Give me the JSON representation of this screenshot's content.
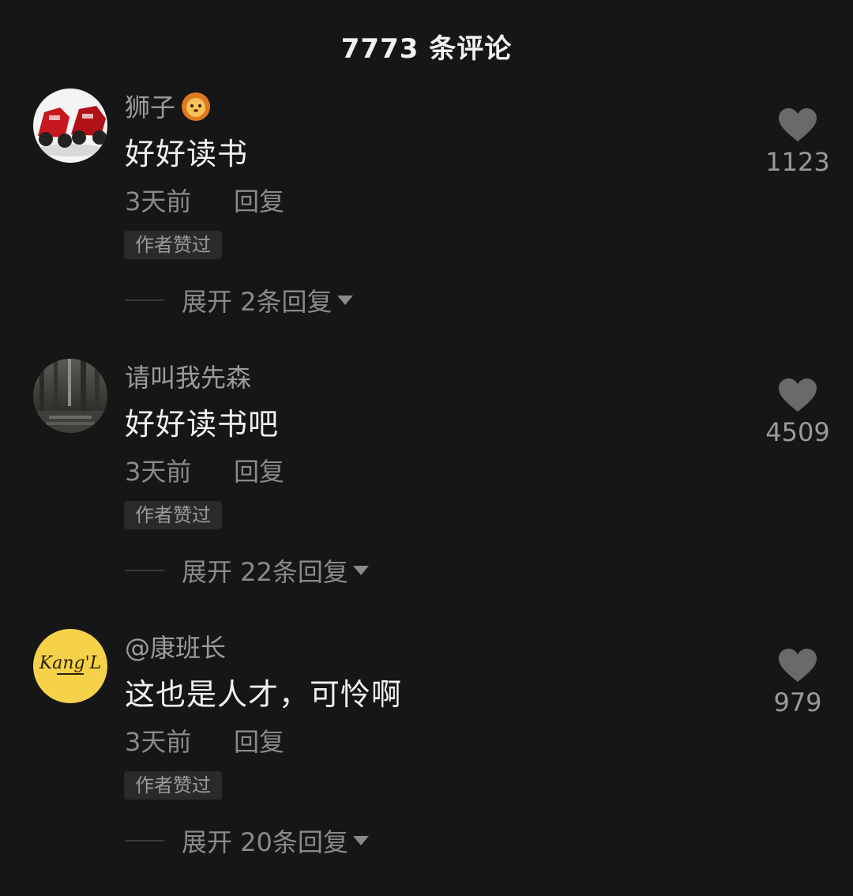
{
  "header": {
    "title": "7773 条评论"
  },
  "comments": [
    {
      "username": "狮子",
      "emoji": "lion-emoji-icon",
      "text": "好好读书",
      "time": "3天前",
      "reply_label": "回复",
      "badge": "作者赞过",
      "expand_label": "展开 2条回复",
      "likes": "1123",
      "avatar": "motorcycle-avatar"
    },
    {
      "username": "请叫我先森",
      "text": "好好读书吧",
      "time": "3天前",
      "reply_label": "回复",
      "badge": "作者赞过",
      "expand_label": "展开 22条回复",
      "likes": "4509",
      "avatar": "forest-avatar"
    },
    {
      "username": "@康班长",
      "text": "这也是人才，可怜啊",
      "time": "3天前",
      "reply_label": "回复",
      "badge": "作者赞过",
      "expand_label": "展开 20条回复",
      "likes": "979",
      "avatar": "kangl-logo-avatar",
      "avatar_logo_text": "Kang'L"
    }
  ],
  "colors": {
    "background": "#161616",
    "avatar_yellow": "#f5d24a",
    "motorcycle_red": "#c8171e"
  }
}
